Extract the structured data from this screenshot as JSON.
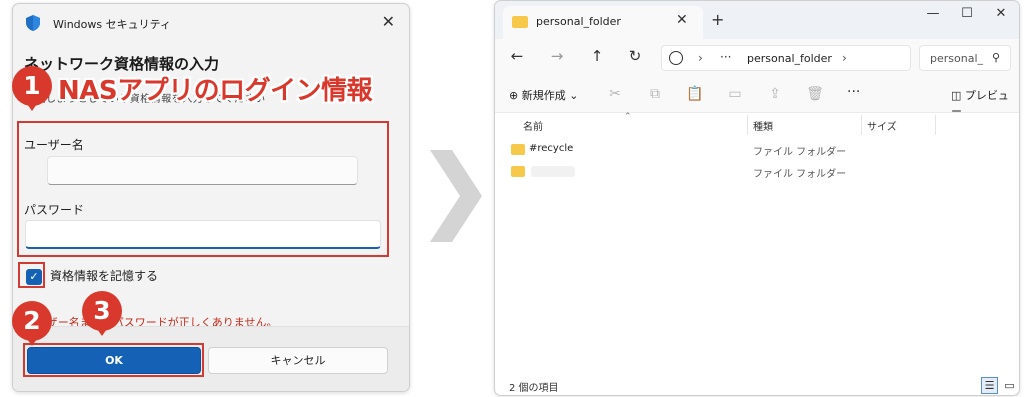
{
  "dialog": {
    "title": "Windows セキュリティ",
    "close_glyph": "✕",
    "heading": "ネットワーク資格情報の入力",
    "subtext": "接続しようとしている資格情報を入力してください",
    "username_label": "ユーザー名",
    "password_label": "パスワード",
    "remember_label": "資格情報を記憶する",
    "remember_checked": true,
    "error_text": "ユーザー名またはパスワードが正しくありません。",
    "ok_label": "OK",
    "cancel_label": "キャンセル"
  },
  "annotations": {
    "step1_number": "1",
    "step1_text": "NASアプリのログイン情報",
    "step2_number": "2",
    "step3_number": "3",
    "highlight_color": "#d9392c"
  },
  "explorer": {
    "tab_title": "personal_folder",
    "tab_close_glyph": "✕",
    "new_tab_glyph": "+",
    "window_controls": [
      "—",
      "☐",
      "✕"
    ],
    "nav": {
      "back": "←",
      "forward": "→",
      "up": "↑",
      "refresh": "↻"
    },
    "address": {
      "ellipsis": "···",
      "path": "personal_folder",
      "sep": "›"
    },
    "search_placeholder": "personal_",
    "toolbar": {
      "new_label": "⊕ 新規作成 ⌄",
      "icons": [
        "cut-icon",
        "copy-icon",
        "paste-icon",
        "rename-icon",
        "share-icon",
        "delete-icon"
      ],
      "more": "···",
      "preview_label": "◫ プレビュー"
    },
    "columns": [
      "名前",
      "種類",
      "サイズ"
    ],
    "sort_caret": "⌃",
    "files": [
      {
        "name": "#recycle",
        "type": "ファイル フォルダー"
      },
      {
        "name": "",
        "type": "ファイル フォルダー"
      }
    ],
    "status_text": "2 個の項目",
    "view_details_glyph": "☰",
    "view_tiles_glyph": "▭"
  },
  "colors": {
    "accent": "#1561b5",
    "error": "#c42b1c",
    "folder": "#f6c94b"
  }
}
